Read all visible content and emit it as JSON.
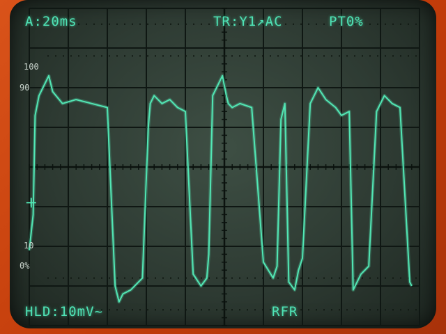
{
  "readouts": {
    "timebase": "A:20ms",
    "trigger": "TR:Y1↗AC",
    "pretrigger": "PT0%",
    "hold": "HLD:10mV~",
    "mode": "RFR"
  },
  "scale_marks": {
    "top": "100",
    "upper": "90",
    "lower": "10",
    "bottom": "0%"
  },
  "colors": {
    "trace": "#52e6b4",
    "grid": "#0f1713",
    "readout": "#4fe3b6",
    "bezel": "#c8400c"
  },
  "chart_data": {
    "type": "line",
    "grid": true,
    "divisions": {
      "x": 10,
      "y": 8
    },
    "series": [
      {
        "x": [
          0,
          0.1,
          0.15,
          0.25,
          0.5,
          0.6,
          0.85,
          1.2,
          1.6,
          2.0,
          2.2,
          2.3,
          2.35,
          2.4,
          2.6,
          2.9,
          3.05,
          3.1,
          3.15,
          3.2,
          3.4,
          3.6,
          3.8,
          4.0,
          4.2,
          4.4,
          4.55,
          4.6,
          4.7,
          4.85,
          4.95,
          5.05,
          5.1,
          5.2,
          5.4,
          5.7,
          6.0,
          6.25,
          6.35,
          6.45,
          6.55,
          6.65,
          6.8,
          6.9,
          7.0,
          7.2,
          7.4,
          7.6,
          7.85,
          8.0,
          8.2,
          8.3,
          8.4,
          8.5,
          8.7,
          8.9,
          9.1,
          9.3,
          9.5,
          9.75,
          9.8
        ],
        "y": [
          -2.1,
          -1.2,
          1.3,
          1.8,
          2.3,
          1.9,
          1.6,
          1.7,
          1.6,
          1.5,
          -3.0,
          -3.4,
          -3.3,
          -3.2,
          -3.1,
          -2.8,
          1.0,
          1.6,
          1.7,
          1.8,
          1.6,
          1.7,
          1.5,
          1.4,
          -2.7,
          -3.0,
          -2.8,
          -2.2,
          1.8,
          2.1,
          2.3,
          1.8,
          1.6,
          1.5,
          1.6,
          1.5,
          -2.4,
          -2.8,
          -2.5,
          1.2,
          1.6,
          -2.9,
          -3.1,
          -2.6,
          -2.3,
          1.6,
          2.0,
          1.7,
          1.5,
          1.3,
          1.4,
          -3.1,
          -2.9,
          -2.7,
          -2.5,
          1.4,
          1.8,
          1.6,
          1.5,
          -2.9,
          -3.0
        ]
      }
    ],
    "markers": [
      {
        "label": "100",
        "y": 3.6
      },
      {
        "label": "90",
        "y": 2.8
      },
      {
        "label": "10",
        "y": -2.8
      },
      {
        "label": "0%",
        "y": -3.6
      }
    ],
    "xlim": [
      0,
      10
    ],
    "ylim": [
      -4,
      4
    ]
  }
}
